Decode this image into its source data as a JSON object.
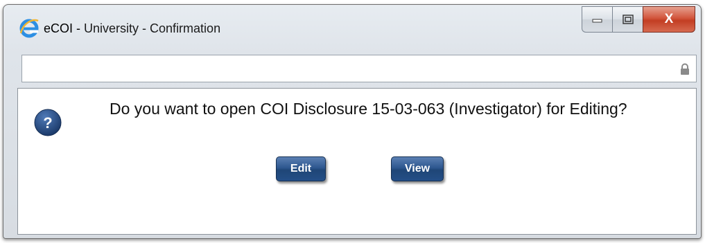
{
  "window": {
    "app_name": "eCOI -",
    "title": "University - Confirmation"
  },
  "caption_buttons": {
    "minimize_icon": "minimize-icon",
    "maximize_icon": "maximize-icon",
    "close_label": "X"
  },
  "address_bar": {
    "value": "",
    "lock_icon": "lock-icon"
  },
  "dialog": {
    "icon": "help-icon",
    "message": "Do you want to open COI Disclosure 15-03-063  (Investigator)  for Editing?",
    "buttons": {
      "edit": "Edit",
      "view": "View"
    }
  },
  "colors": {
    "button": "#2e578f",
    "help_icon": "#2a4f86",
    "close_button": "#c9452b"
  }
}
